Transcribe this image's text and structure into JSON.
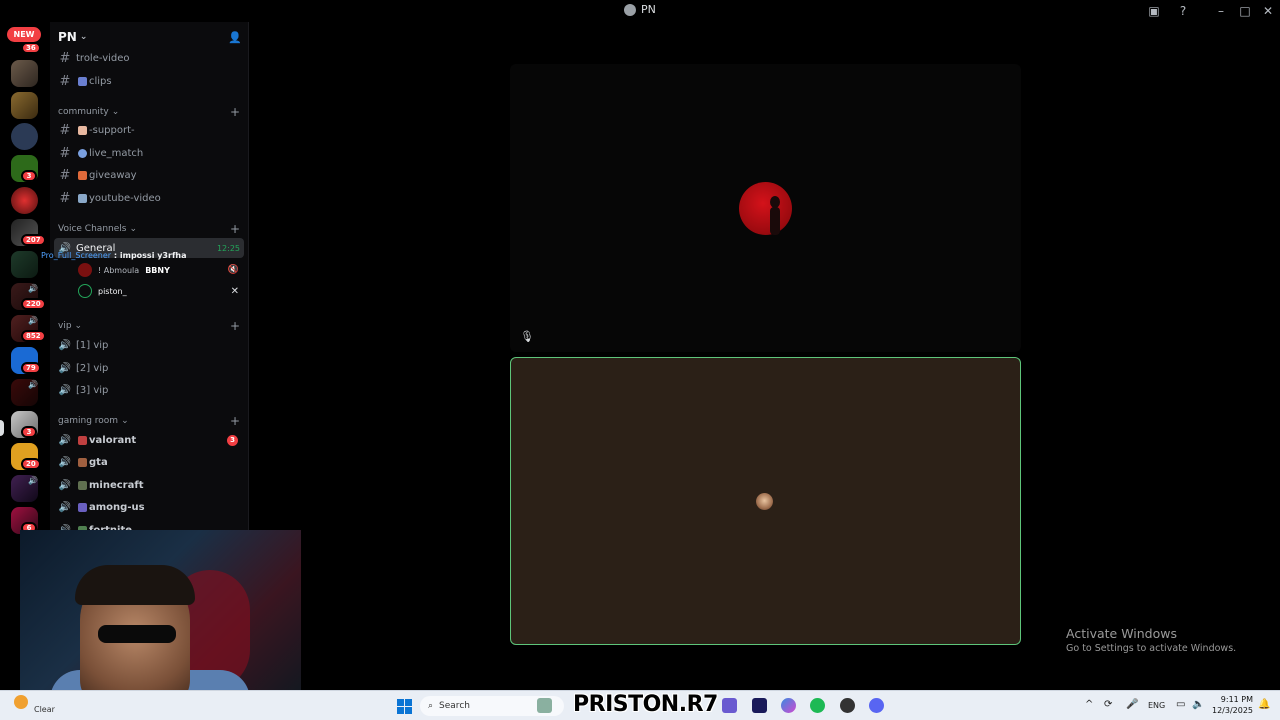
{
  "window": {
    "title": "PN"
  },
  "rail": {
    "new_badge": "NEW",
    "badges": [
      "36",
      "3",
      "207",
      "220",
      "852",
      "79",
      "3",
      "20",
      "6"
    ]
  },
  "sidebar": {
    "server_name": "PN",
    "channels_top": [
      {
        "label": "trole-video"
      },
      {
        "label": "clips"
      }
    ],
    "community": {
      "label": "community",
      "channels": [
        {
          "label": "-support-"
        },
        {
          "label": "live_match"
        },
        {
          "label": "giveaway"
        },
        {
          "label": "youtube-video"
        }
      ]
    },
    "voice": {
      "label": "Voice Channels",
      "general": {
        "label": "General",
        "time": "12:25"
      },
      "activity": {
        "name": "Pro_Full_Screener",
        "text": " : impossi y3rfha"
      },
      "users": [
        {
          "name": "! Abmoula",
          "tag": "BBNY"
        },
        {
          "name": "piston_"
        }
      ]
    },
    "vip": {
      "label": "vip",
      "channels": [
        {
          "label": "[1] vip"
        },
        {
          "label": "[2] vip"
        },
        {
          "label": "[3] vip"
        }
      ]
    },
    "gaming": {
      "label": "gaming room",
      "channels": [
        {
          "label": "valorant",
          "ping": "3"
        },
        {
          "label": "gta"
        },
        {
          "label": "minecraft"
        },
        {
          "label": "among-us"
        },
        {
          "label": "fortnite"
        }
      ]
    }
  },
  "overlay": {
    "activate_title": "Activate Windows",
    "activate_sub": "Go to Settings to activate Windows."
  },
  "taskbar": {
    "weather": "Clear",
    "search_placeholder": "Search",
    "brand": "PRISTON.R7",
    "lang": "ENG",
    "time": "9:11 PM",
    "date": "12/3/2025"
  },
  "colors": {
    "accent_green": "#23a55a",
    "badge_red": "#f23f43",
    "speaking_border": "#5ec57a",
    "link_blue": "#4ea1ff"
  }
}
